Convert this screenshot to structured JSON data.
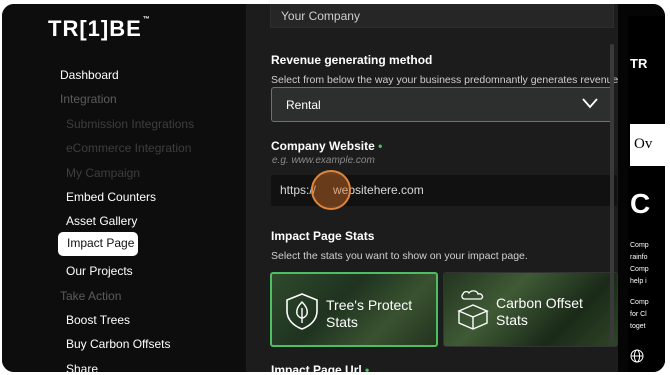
{
  "sidebar": {
    "logo": "TR[1]BE",
    "logo_mark": "™",
    "items": [
      {
        "label": "Dashboard"
      },
      {
        "label": "Integration"
      },
      {
        "label": "Submission Integrations"
      },
      {
        "label": "eCommerce Integration"
      },
      {
        "label": "My Campaign"
      },
      {
        "label": "Embed Counters"
      },
      {
        "label": "Asset Gallery"
      },
      {
        "label": "Impact Page"
      },
      {
        "label": "Our Projects"
      },
      {
        "label": "Take Action"
      },
      {
        "label": "Boost Trees"
      },
      {
        "label": "Buy Carbon Offsets"
      },
      {
        "label": "Share"
      }
    ]
  },
  "form": {
    "company_value": "Your Company",
    "revenue_label": "Revenue generating method",
    "revenue_help": "Select from below the way your business predomnantly generates revenue.",
    "revenue_value": "Rental",
    "website_label": "Company Website",
    "required_mark": "•",
    "website_placeholder": "e.g. www.example.com",
    "website_prefix": "https://",
    "website_value": "websitehere.com",
    "stats_label": "Impact Page Stats",
    "stats_help": "Select the stats you want to show on your impact page.",
    "stats_options": [
      {
        "label": "Tree's Protect Stats",
        "icon": "shield-tree-icon",
        "selected": true
      },
      {
        "label": "Carbon Offset Stats",
        "icon": "co2-box-icon",
        "selected": false
      }
    ],
    "url_label": "Impact Page Url"
  },
  "preview": {
    "brand": "TR",
    "logo_fragment": "Ov",
    "heading": "C",
    "lines": [
      "Comp",
      "rainfo",
      "Comp",
      "help i",
      "Comp",
      "for Cl",
      "toget"
    ]
  },
  "colors": {
    "accent_green": "#4bbf61",
    "cursor_orange": "#e0853c"
  }
}
